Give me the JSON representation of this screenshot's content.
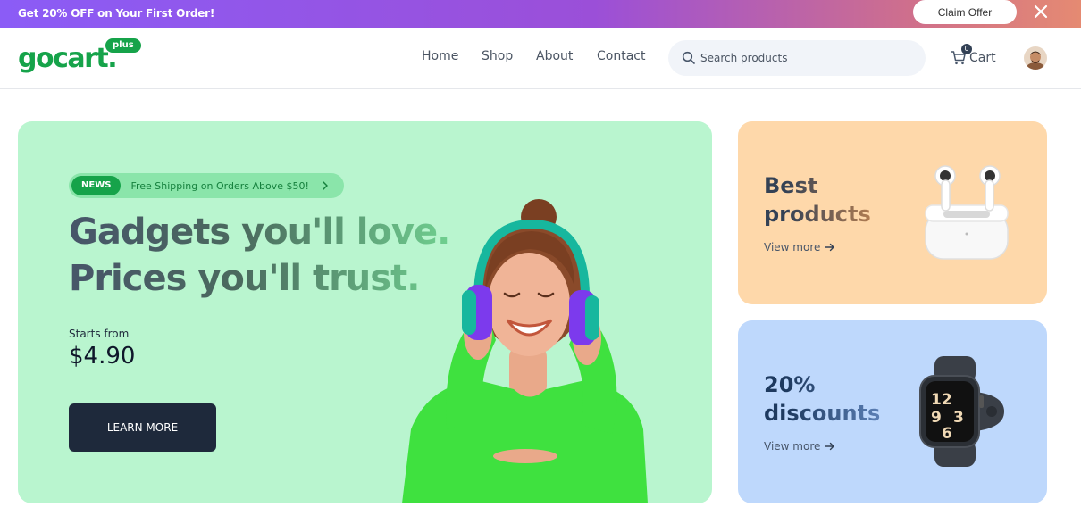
{
  "promo": {
    "message": "Get 20% OFF on Your First Order!",
    "claim_label": "Claim Offer",
    "background": "#8b5cf6"
  },
  "header": {
    "logo_text": "gocart",
    "logo_dot": ".",
    "logo_badge": "plus",
    "nav": [
      "Home",
      "Shop",
      "About",
      "Contact"
    ],
    "search_placeholder": "Search products",
    "cart_label": "Cart",
    "cart_count": "0"
  },
  "hero": {
    "news_tag": "NEWS",
    "news_text": "Free Shipping on Orders Above $50!",
    "headline_line1": "Gadgets you'll love.",
    "headline_line2": "Prices you'll trust.",
    "starts_label": "Starts from",
    "price": "$4.90",
    "cta_label": "LEARN MORE",
    "background": "#b9f5cf"
  },
  "cards": [
    {
      "title_line1": "Best",
      "title_line2": "products",
      "link_label": "View more",
      "background": "#fed8aa",
      "image": "airpods-icon"
    },
    {
      "title_line1": "20%",
      "title_line2": "discounts",
      "link_label": "View more",
      "background": "#bed8fc",
      "image": "smartwatch-icon"
    }
  ],
  "colors": {
    "brand": "#16a34a",
    "dark": "#1e293b"
  }
}
